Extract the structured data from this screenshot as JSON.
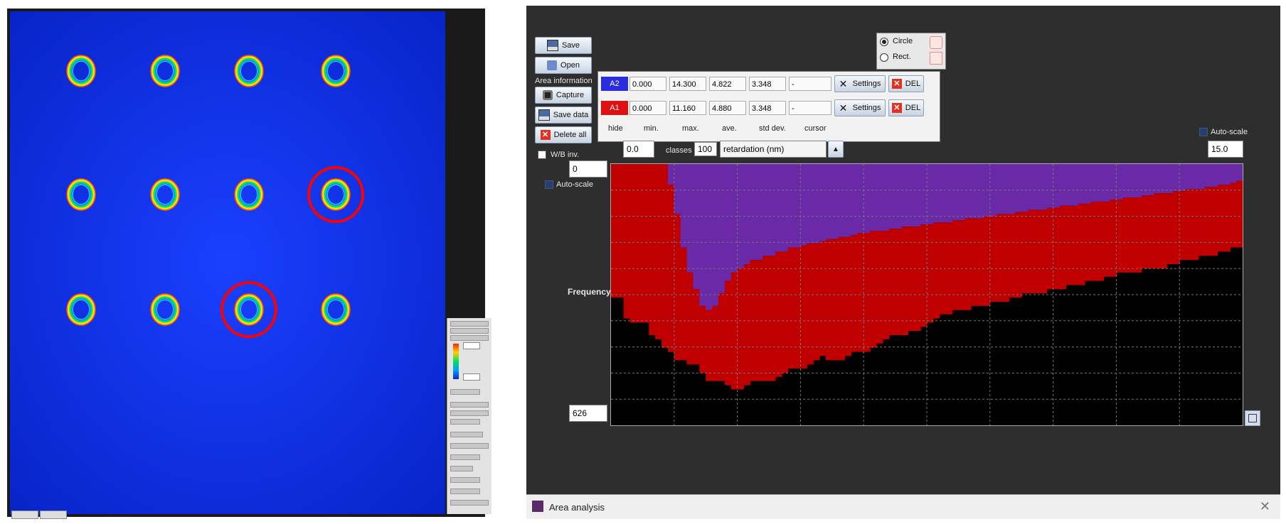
{
  "left_viewer": {
    "side_panel_fields": [
      "",
      ""
    ],
    "bottom_tabs": [
      "",
      ""
    ]
  },
  "area_window": {
    "title": "Area analysis",
    "close_glyph": "✕",
    "buttons": {
      "save": "Save",
      "open": "Open",
      "capture": "Capture",
      "save_data": "Save data",
      "delete_all": "Delete all"
    },
    "area_information_label": "Area information",
    "wb_label": "W/B inv.",
    "shape_options": [
      {
        "label": "Circle",
        "selected": true
      },
      {
        "label": "Rect.",
        "selected": false
      }
    ],
    "stats": {
      "headers": [
        "hide",
        "min.",
        "max.",
        "ave.",
        "std dev.",
        "cursor"
      ],
      "rows": [
        {
          "name": "A2",
          "color": "#2b2be0",
          "min": "0.000",
          "max": "14.300",
          "ave": "4.822",
          "std": "3.348",
          "cursor": "-",
          "settings": "Settings",
          "del": "DEL"
        },
        {
          "name": "A1",
          "color": "#e01010",
          "min": "0.000",
          "max": "11.160",
          "ave": "4.880",
          "std": "3.348",
          "cursor": "-",
          "settings": "Settings",
          "del": "DEL"
        }
      ]
    },
    "x_min": "0.0",
    "x_max": "15.0",
    "classes_label": "classes",
    "classes_value": "100",
    "quantity_select": "retardation (nm)",
    "y_max": "0",
    "y_min": "626",
    "auto_scale_x": "Auto-scale",
    "auto_scale_y": "Auto-scale",
    "y_axis_label": "Frequency"
  },
  "colors": {
    "viewer_background": "#0a2fe6",
    "area1_red": "#c00000",
    "area2_blue": "#2a2ab8",
    "overlap_purple": "#6a2aa8",
    "window_dark": "#2e2e2e"
  },
  "chart_data": {
    "type": "bar",
    "xlabel": "",
    "ylabel": "Frequency",
    "xlim": [
      0.0,
      15.0
    ],
    "ylim": [
      0,
      626
    ],
    "classes": 100,
    "series": [
      {
        "name": "A1",
        "values": [
          320,
          320,
          370,
          380,
          380,
          380,
          410,
          420,
          440,
          450,
          470,
          470,
          480,
          480,
          500,
          520,
          520,
          520,
          530,
          540,
          540,
          530,
          520,
          520,
          520,
          520,
          510,
          500,
          490,
          490,
          490,
          480,
          470,
          460,
          470,
          470,
          470,
          460,
          450,
          450,
          450,
          440,
          430,
          420,
          410,
          410,
          410,
          400,
          400,
          390,
          380,
          370,
          360,
          360,
          350,
          350,
          350,
          340,
          340,
          340,
          330,
          330,
          330,
          320,
          320,
          310,
          310,
          310,
          310,
          300,
          300,
          300,
          290,
          290,
          290,
          280,
          280,
          280,
          270,
          270,
          260,
          260,
          260,
          260,
          250,
          250,
          250,
          250,
          240,
          240,
          230,
          230,
          230,
          220,
          220,
          220,
          210,
          210,
          200,
          200
        ]
      },
      {
        "name": "A2",
        "values": [
          0,
          0,
          0,
          0,
          0,
          0,
          0,
          0,
          0,
          50,
          120,
          200,
          260,
          300,
          340,
          350,
          340,
          310,
          280,
          260,
          250,
          240,
          230,
          230,
          220,
          220,
          210,
          210,
          200,
          200,
          195,
          190,
          190,
          185,
          180,
          180,
          175,
          175,
          170,
          165,
          165,
          160,
          160,
          160,
          155,
          155,
          150,
          150,
          150,
          145,
          145,
          140,
          140,
          140,
          135,
          135,
          130,
          130,
          130,
          125,
          125,
          120,
          120,
          120,
          115,
          115,
          110,
          110,
          110,
          105,
          105,
          100,
          100,
          100,
          95,
          95,
          90,
          90,
          90,
          85,
          85,
          80,
          80,
          80,
          75,
          75,
          70,
          70,
          70,
          65,
          65,
          60,
          60,
          60,
          55,
          55,
          50,
          50,
          45,
          40
        ]
      }
    ]
  }
}
